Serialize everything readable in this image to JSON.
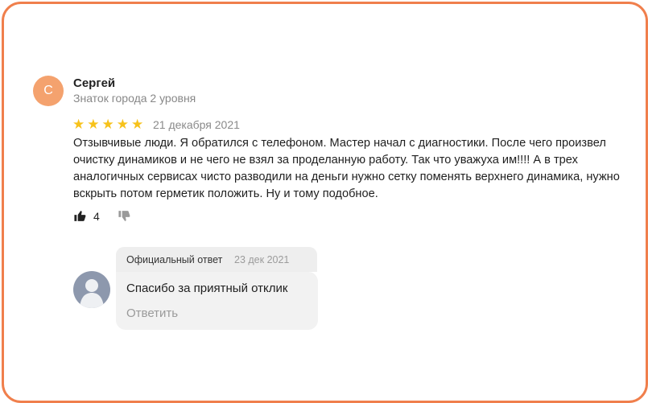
{
  "review": {
    "avatar_letter": "С",
    "author": "Сергей",
    "level": "Знаток города 2 уровня",
    "rating": 5,
    "date": "21 декабря 2021",
    "text": "Отзывчивые люди. Я обратился с телефоном. Мастер начал с диагностики. После чего произвел очистку динамиков и не чего не взял за проделанную работу. Так что уважуха им!!!! А в трех аналогичных сервисах чисто разводили на деньги нужно сетку поменять верхнего динамика, нужно вскрыть потом герметик положить. Ну и тому подобное.",
    "likes": "4",
    "icons": {
      "like": "thumbs-up-icon",
      "dislike": "thumbs-down-icon",
      "star": "star-icon"
    }
  },
  "reply": {
    "label": "Официальный ответ",
    "date": "23 дек 2021",
    "text": "Спасибо за приятный отклик",
    "action": "Ответить"
  },
  "colors": {
    "accent": "#f07f4c",
    "star": "#f7c21b",
    "avatar": "#f4a26e"
  }
}
